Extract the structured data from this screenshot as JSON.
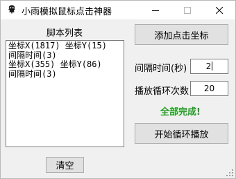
{
  "window": {
    "title": "小雨模拟鼠标点击神器",
    "icon": "app-icon",
    "controls": [
      "minimize-icon",
      "maximize-icon",
      "close-icon"
    ]
  },
  "script_panel": {
    "heading": "脚本列表",
    "lines": [
      "坐标X(1817) 坐标Y(15)",
      "间隔时间(3)",
      "坐标X(355) 坐标Y(86)",
      "间隔时间(3)"
    ],
    "clear_label": "清空"
  },
  "controls": {
    "add_label": "添加点击坐标",
    "interval_label": "间隔时间(秒)",
    "interval_value": "2",
    "loop_label": "播放循环次数",
    "loop_value": "20",
    "status": "全部完成!",
    "start_label": "开始循环播放"
  },
  "colors": {
    "status": "#1f9d1f",
    "background": "#f0f0f0",
    "button": "#e1e1e1"
  }
}
